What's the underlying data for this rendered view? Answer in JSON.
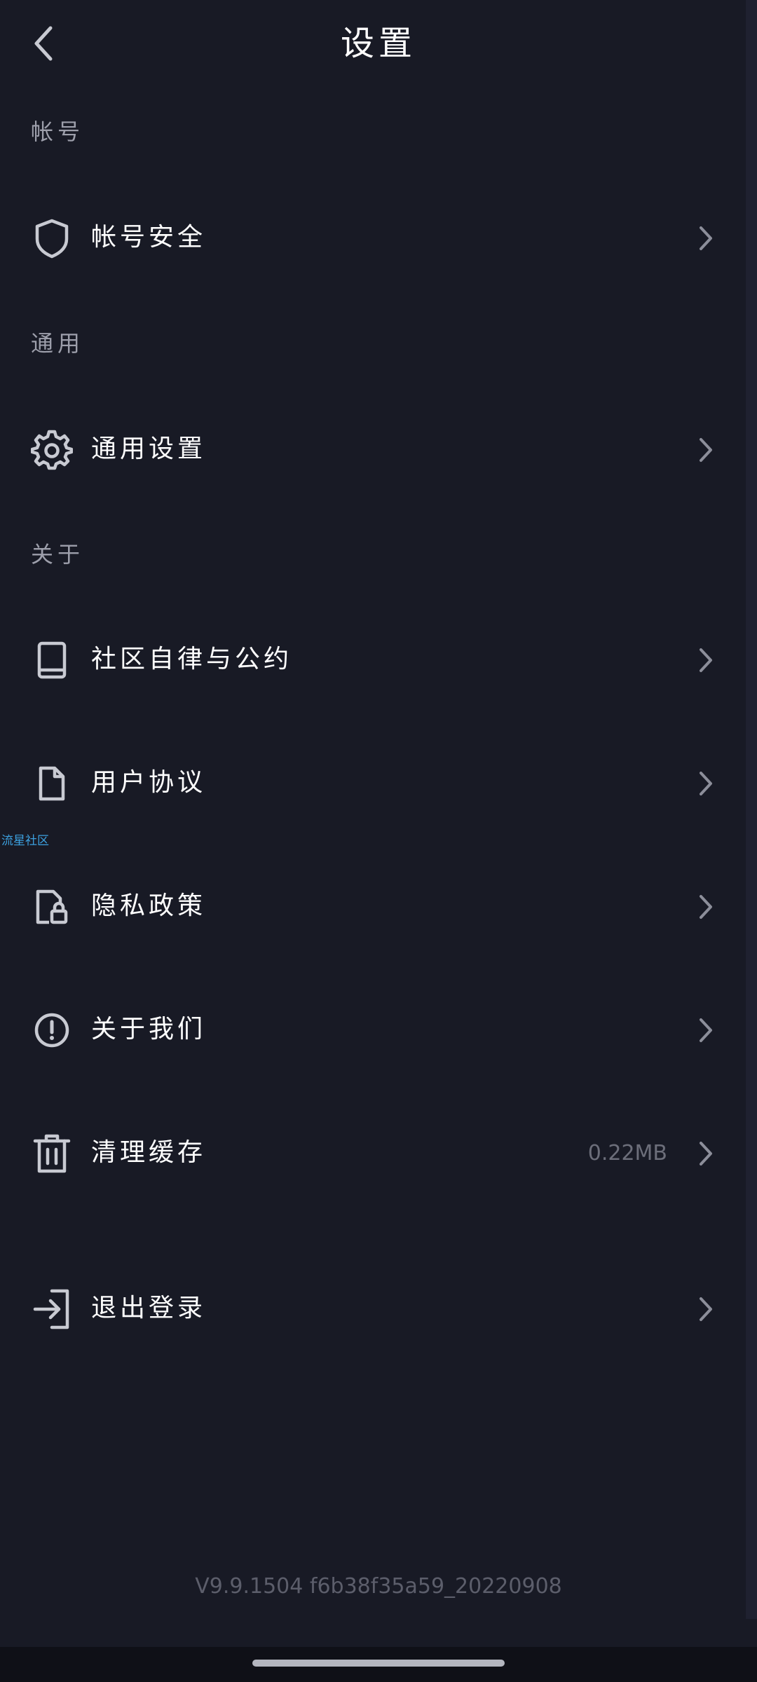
{
  "header": {
    "title": "设置",
    "back_icon": "chevron-left-icon"
  },
  "sections": [
    {
      "label": "帐号"
    },
    {
      "label": "通用"
    },
    {
      "label": "关于"
    }
  ],
  "items": [
    {
      "label": "帐号安全",
      "icon": "shield-icon"
    },
    {
      "label": "通用设置",
      "icon": "gear-icon"
    },
    {
      "label": "社区自律与公约",
      "icon": "book-icon"
    },
    {
      "label": "用户协议",
      "icon": "document-icon"
    },
    {
      "label": "隐私政策",
      "icon": "document-lock-icon"
    },
    {
      "label": "关于我们",
      "icon": "info-circle-icon"
    },
    {
      "label": "清理缓存",
      "icon": "trash-icon",
      "value": "0.22MB"
    },
    {
      "label": "退出登录",
      "icon": "logout-icon"
    }
  ],
  "watermark": "流星社区",
  "footer": {
    "version": "V9.9.1504 f6b38f35a59_20220908"
  },
  "colors": {
    "background": "#181a25",
    "text": "#ffffff",
    "section_label": "#9d9fab",
    "muted": "#6c6e7a",
    "watermark": "#3ca1e0"
  }
}
